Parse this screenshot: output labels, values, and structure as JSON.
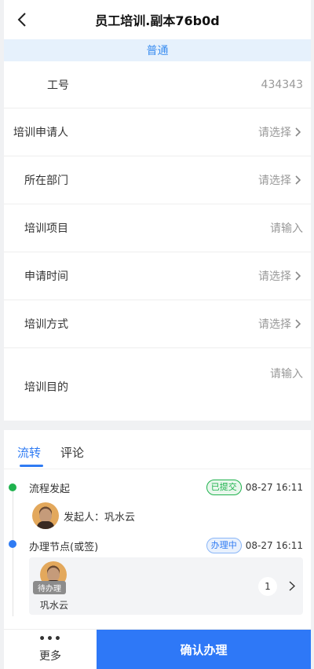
{
  "header": {
    "title": "员工培训.副本76b0d"
  },
  "banner": {
    "text": "普通"
  },
  "form": {
    "employee_id": {
      "label": "工号",
      "value": "434343"
    },
    "applicant": {
      "label": "培训申请人",
      "value": "请选择"
    },
    "department": {
      "label": "所在部门",
      "value": "请选择"
    },
    "project": {
      "label": "培训项目",
      "value": "请输入"
    },
    "apply_time": {
      "label": "申请时间",
      "value": "请选择"
    },
    "mode": {
      "label": "培训方式",
      "value": "请选择"
    },
    "purpose": {
      "label": "培训目的",
      "value": "请输入"
    }
  },
  "tabs": [
    {
      "label": "流转",
      "active": true
    },
    {
      "label": "评论",
      "active": false
    }
  ],
  "timeline": {
    "step1": {
      "title": "流程发起",
      "status": "已提交",
      "time": "08-27 16:11",
      "initiator": "发起人：巩水云"
    },
    "step2": {
      "title": "办理节点(或签)",
      "status": "办理中",
      "time": "08-27 16:11",
      "pending_tag": "待办理",
      "handler": "巩水云",
      "count": "1"
    }
  },
  "bottom": {
    "more_dots": "•••",
    "more_label": "更多",
    "confirm_label": "确认办理"
  },
  "colors": {
    "accent": "#2f7bf3",
    "green": "#1fb24e",
    "banner_bg": "#e6f1fc"
  }
}
